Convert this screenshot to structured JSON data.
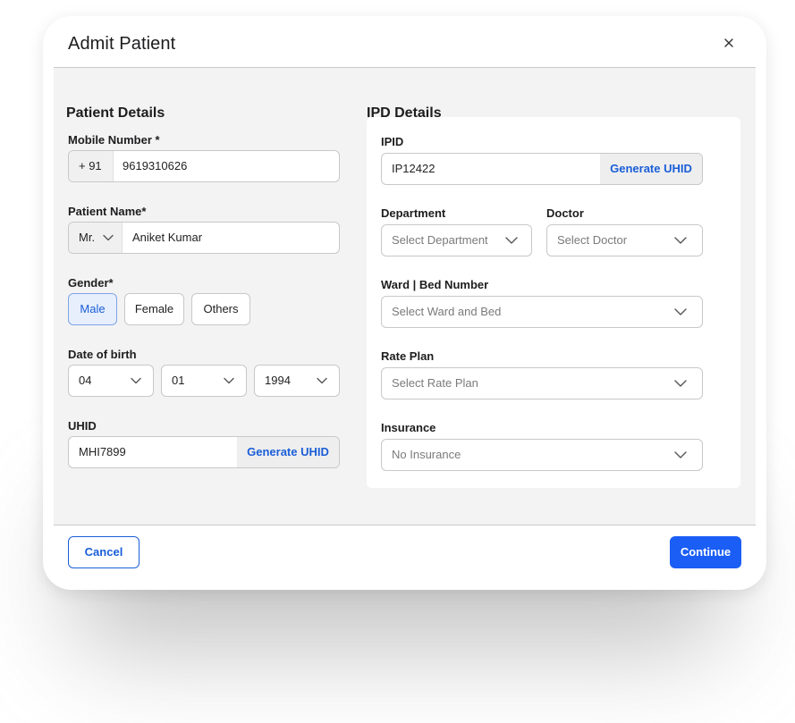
{
  "modal": {
    "title": "Admit Patient",
    "close_icon": "close-icon"
  },
  "patient_details": {
    "section_title": "Patient Details",
    "mobile": {
      "label": "Mobile Number *",
      "country_code": "+ 91",
      "value": "9619310626"
    },
    "name": {
      "label": "Patient Name*",
      "salutation": "Mr.",
      "value": "Aniket Kumar"
    },
    "gender": {
      "label": "Gender*",
      "options": [
        "Male",
        "Female",
        "Others"
      ],
      "selected": "Male"
    },
    "dob": {
      "label": "Date of birth",
      "day": "04",
      "month": "01",
      "year": "1994"
    },
    "uhid": {
      "label": "UHID",
      "value": "MHI7899",
      "generate_label": "Generate UHID"
    }
  },
  "ipd_details": {
    "section_title": "IPD Details",
    "ipid": {
      "label": "IPID",
      "value": "IP12422",
      "generate_label": "Generate UHID"
    },
    "department": {
      "label": "Department",
      "placeholder": "Select Department"
    },
    "doctor": {
      "label": "Doctor",
      "placeholder": "Select Doctor"
    },
    "ward_bed": {
      "label": "Ward | Bed Number",
      "placeholder": "Select Ward and Bed"
    },
    "rate_plan": {
      "label": "Rate Plan",
      "placeholder": "Select Rate Plan"
    },
    "insurance": {
      "label": "Insurance",
      "value": "No Insurance"
    }
  },
  "footer": {
    "cancel_label": "Cancel",
    "continue_label": "Continue"
  },
  "colors": {
    "accent": "#1a5ef5",
    "link": "#1a5ed8",
    "selected_chip_bg": "#e7effc",
    "body_bg": "#f3f3f3"
  }
}
